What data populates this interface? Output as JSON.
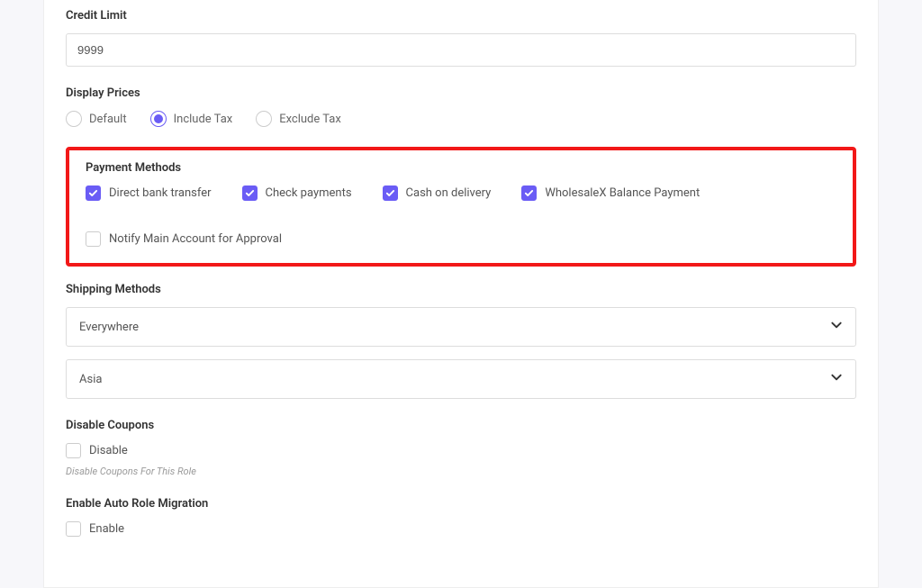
{
  "credit_limit": {
    "label": "Credit Limit",
    "value": "9999"
  },
  "display_prices": {
    "label": "Display Prices",
    "options": [
      {
        "label": "Default",
        "checked": false
      },
      {
        "label": "Include Tax",
        "checked": true
      },
      {
        "label": "Exclude Tax",
        "checked": false
      }
    ]
  },
  "payment_methods": {
    "label": "Payment Methods",
    "options": [
      {
        "label": "Direct bank transfer",
        "checked": true
      },
      {
        "label": "Check payments",
        "checked": true
      },
      {
        "label": "Cash on delivery",
        "checked": true
      },
      {
        "label": "WholesaleX Balance Payment",
        "checked": true
      },
      {
        "label": "Notify Main Account for Approval",
        "checked": false
      }
    ]
  },
  "shipping_methods": {
    "label": "Shipping Methods",
    "selects": [
      {
        "value": "Everywhere"
      },
      {
        "value": "Asia"
      }
    ]
  },
  "disable_coupons": {
    "label": "Disable Coupons",
    "option_label": "Disable",
    "checked": false,
    "hint": "Disable Coupons For This Role"
  },
  "auto_role_migration": {
    "label": "Enable Auto Role Migration",
    "option_label": "Enable",
    "checked": false
  }
}
